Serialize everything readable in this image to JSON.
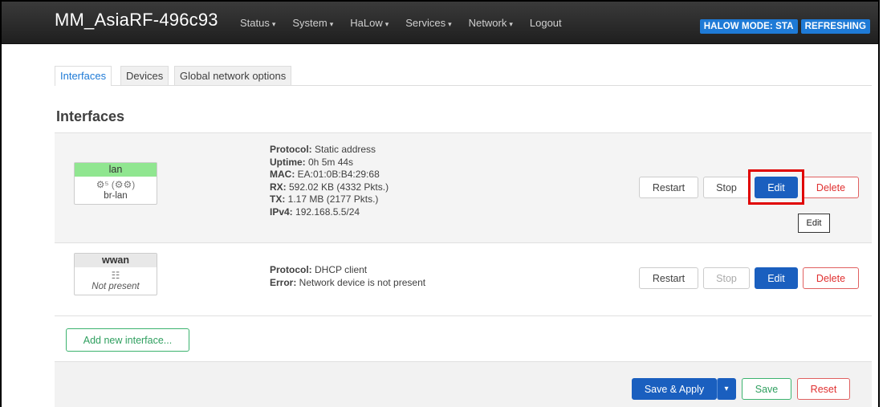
{
  "header": {
    "brand": "MM_AsiaRF-496c93",
    "menu": [
      {
        "label": "Status",
        "caret": "▾"
      },
      {
        "label": "System",
        "caret": "▾"
      },
      {
        "label": "HaLow",
        "caret": "▾"
      },
      {
        "label": "Services",
        "caret": "▾"
      },
      {
        "label": "Network",
        "caret": "▾"
      },
      {
        "label": "Logout",
        "caret": ""
      }
    ],
    "indicators": [
      "HALOW MODE: STA",
      "REFRESHING"
    ],
    "indicator_color": "#1e7ad6"
  },
  "tabs": [
    {
      "label": "Interfaces",
      "active": true
    },
    {
      "label": "Devices",
      "active": false
    },
    {
      "label": "Global network options",
      "active": false
    }
  ],
  "section_title": "Interfaces",
  "interfaces": [
    {
      "name": "lan",
      "icons": "⚙⁵ (⚙⚙)",
      "device": "br-lan",
      "status_color": "#90e690",
      "details": [
        {
          "label": "Protocol:",
          "value": " Static address"
        },
        {
          "label": "Uptime:",
          "value": " 0h 5m 44s"
        },
        {
          "label": "MAC:",
          "value": " EA:01:0B:B4:29:68"
        },
        {
          "label": "RX:",
          "value": " 592.02 KB (4332 Pkts.)"
        },
        {
          "label": "TX:",
          "value": " 1.17 MB (2177 Pkts.)"
        },
        {
          "label": "IPv4:",
          "value": " 192.168.5.5/24"
        }
      ],
      "buttons": {
        "restart": "Restart",
        "stop": "Stop",
        "edit": "Edit",
        "delete": "Delete"
      }
    },
    {
      "name": "wwan",
      "icons": "☷",
      "device": "Not present",
      "status_color": "#e8e8e8",
      "details": [
        {
          "label": "Protocol:",
          "value": " DHCP client"
        },
        {
          "label": "Error:",
          "value": " Network device is not present"
        }
      ],
      "buttons": {
        "restart": "Restart",
        "stop": "Stop",
        "edit": "Edit",
        "delete": "Delete"
      }
    }
  ],
  "tooltip": "Edit",
  "add_interface_label": "Add new interface...",
  "footer": {
    "save_apply": "Save & Apply",
    "caret": "▾",
    "save": "Save",
    "reset": "Reset"
  },
  "colors": {
    "primary": "#1a5fbf",
    "danger": "#e03030",
    "success": "#2f9f5f",
    "highlight": "#e00000"
  }
}
